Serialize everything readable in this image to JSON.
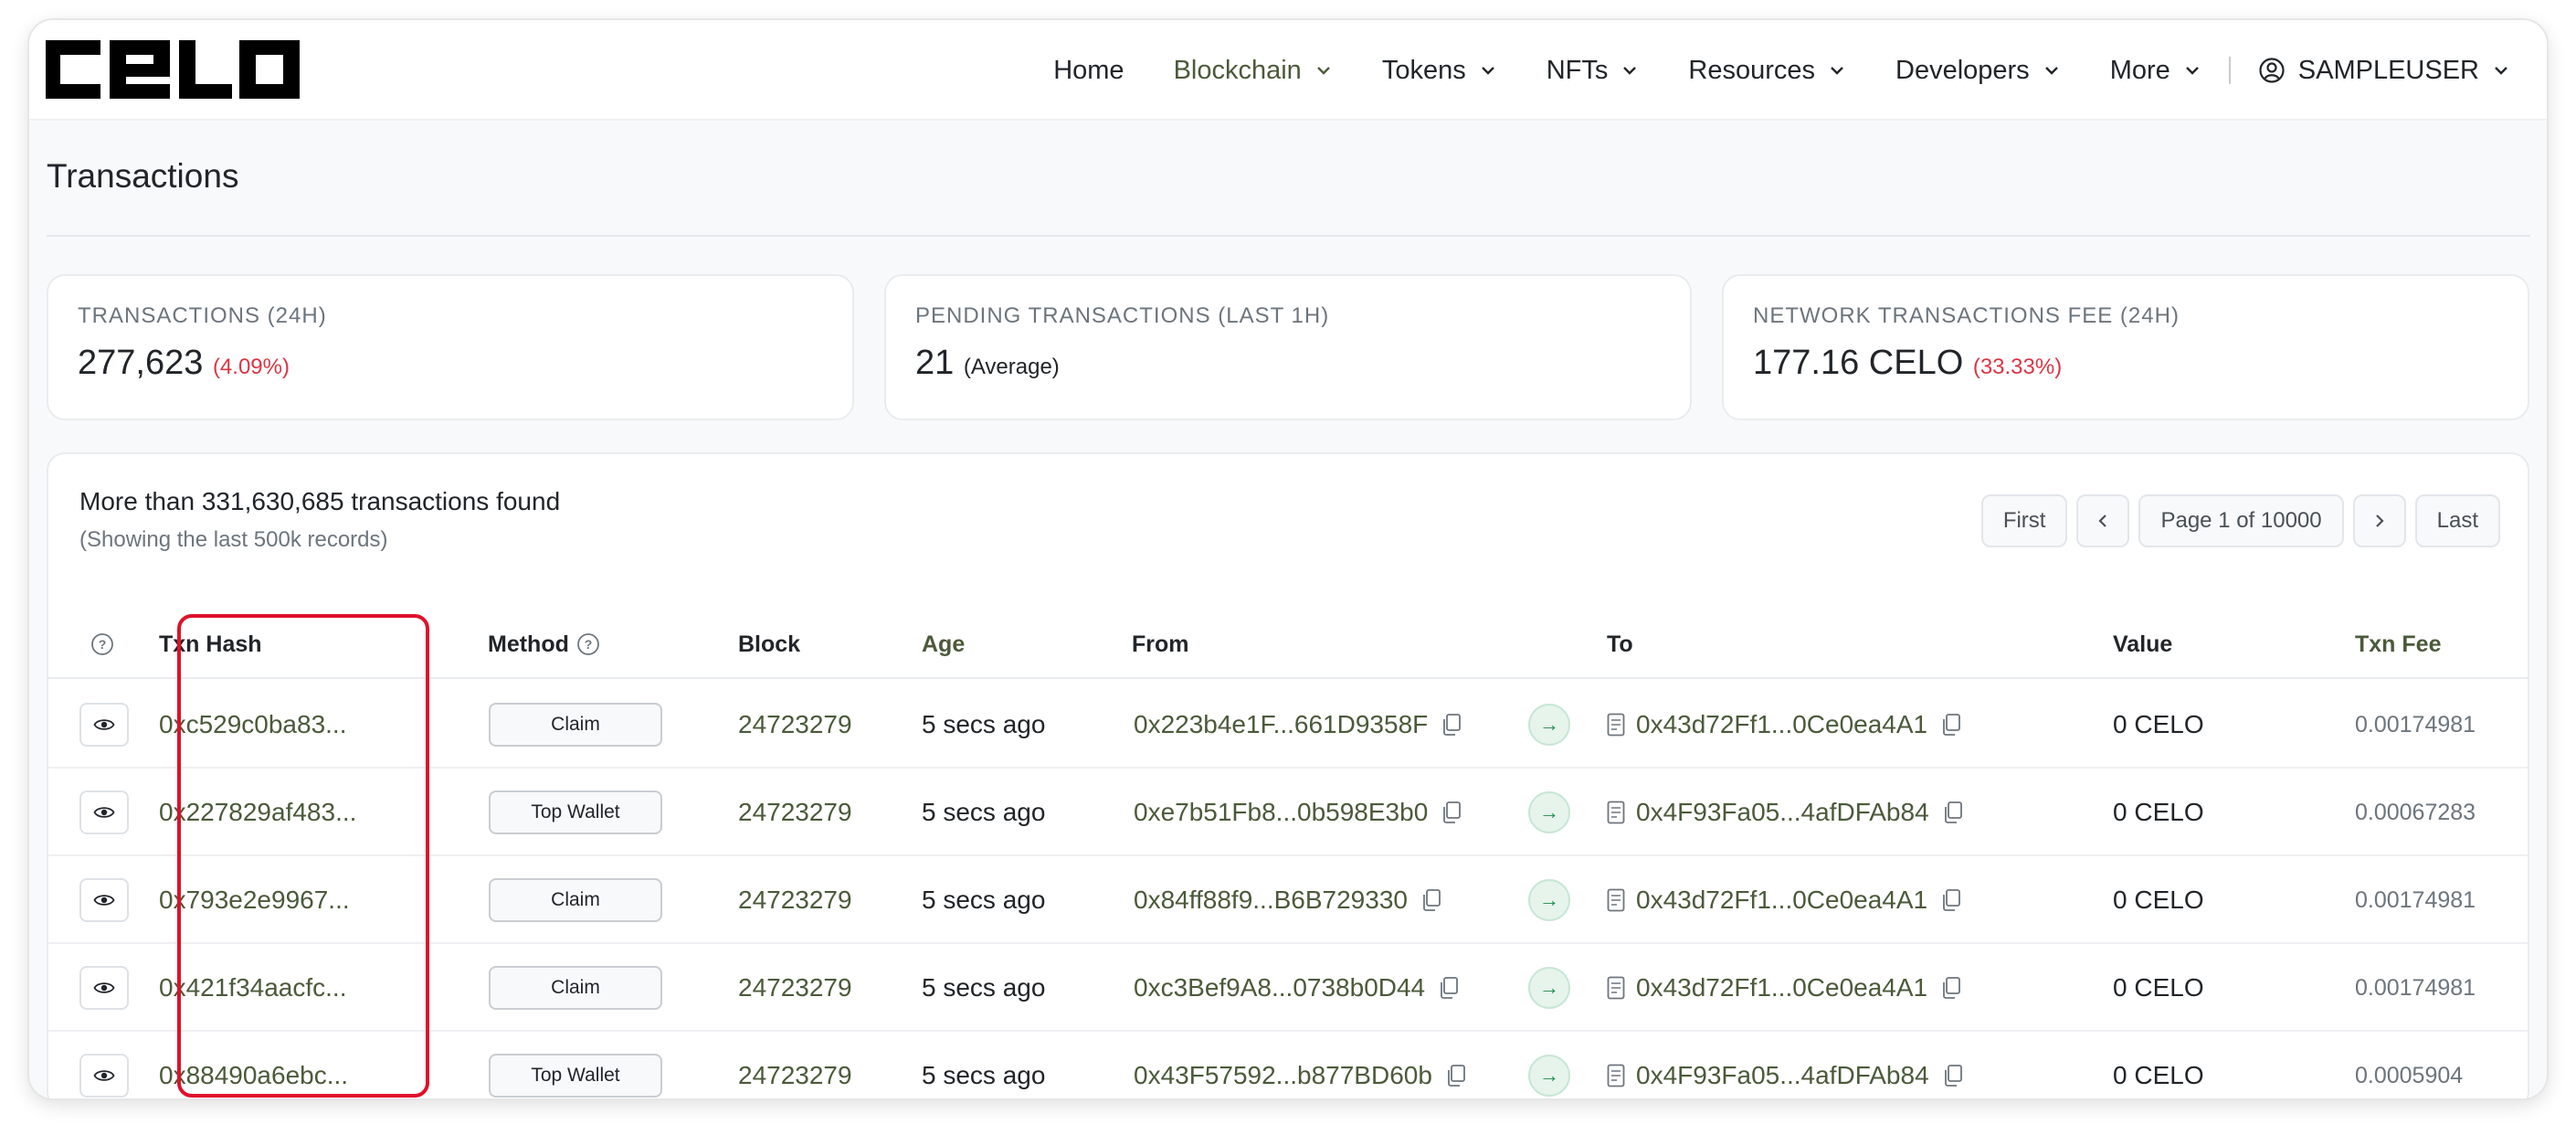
{
  "nav": {
    "items": [
      {
        "label": "Home",
        "dropdown": false,
        "active": false
      },
      {
        "label": "Blockchain",
        "dropdown": true,
        "active": true
      },
      {
        "label": "Tokens",
        "dropdown": true,
        "active": false
      },
      {
        "label": "NFTs",
        "dropdown": true,
        "active": false
      },
      {
        "label": "Resources",
        "dropdown": true,
        "active": false
      },
      {
        "label": "Developers",
        "dropdown": true,
        "active": false
      },
      {
        "label": "More",
        "dropdown": true,
        "active": false
      }
    ],
    "user": "SAMPLEUSER"
  },
  "page": {
    "title": "Transactions"
  },
  "stats": [
    {
      "label": "TRANSACTIONS (24H)",
      "value": "277,623",
      "sub": "(4.09%)",
      "sub_color": "red"
    },
    {
      "label": "PENDING TRANSACTIONS (LAST 1H)",
      "value": "21",
      "sub": "(Average)",
      "sub_color": "dark"
    },
    {
      "label": "NETWORK TRANSACTIONS FEE (24H)",
      "value": "177.16 CELO",
      "sub": "(33.33%)",
      "sub_color": "red"
    }
  ],
  "summary": {
    "found": "More than 331,630,685 transactions found",
    "showing": "(Showing the last 500k records)"
  },
  "pager": {
    "first": "First",
    "info": "Page 1 of 10000",
    "last": "Last"
  },
  "columns": {
    "hash": "Txn Hash",
    "method": "Method",
    "block": "Block",
    "age": "Age",
    "from": "From",
    "to": "To",
    "value": "Value",
    "fee": "Txn Fee"
  },
  "rows": [
    {
      "hash": "0xc529c0ba83...",
      "method": "Claim",
      "block": "24723279",
      "age": "5 secs ago",
      "from": "0x223b4e1F...661D9358F",
      "to": "0x43d72Ff1...0Ce0ea4A1",
      "value": "0 CELO",
      "fee": "0.00174981"
    },
    {
      "hash": "0x227829af483...",
      "method": "Top Wallet",
      "block": "24723279",
      "age": "5 secs ago",
      "from": "0xe7b51Fb8...0b598E3b0",
      "to": "0x4F93Fa05...4afDFAb84",
      "value": "0 CELO",
      "fee": "0.00067283"
    },
    {
      "hash": "0x793e2e9967...",
      "method": "Claim",
      "block": "24723279",
      "age": "5 secs ago",
      "from": "0x84ff88f9...B6B729330",
      "to": "0x43d72Ff1...0Ce0ea4A1",
      "value": "0 CELO",
      "fee": "0.00174981"
    },
    {
      "hash": "0x421f34aacfc...",
      "method": "Claim",
      "block": "24723279",
      "age": "5 secs ago",
      "from": "0xc3Bef9A8...0738b0D44",
      "to": "0x43d72Ff1...0Ce0ea4A1",
      "value": "0 CELO",
      "fee": "0.00174981"
    },
    {
      "hash": "0x88490a6ebc...",
      "method": "Top Wallet",
      "block": "24723279",
      "age": "5 secs ago",
      "from": "0x43F57592...b877BD60b",
      "to": "0x4F93Fa05...4afDFAb84",
      "value": "0 CELO",
      "fee": "0.0005904"
    }
  ],
  "colors": {
    "accent": "#4b5a3a",
    "highlight": "#e0102a",
    "negative": "#dc3545"
  }
}
